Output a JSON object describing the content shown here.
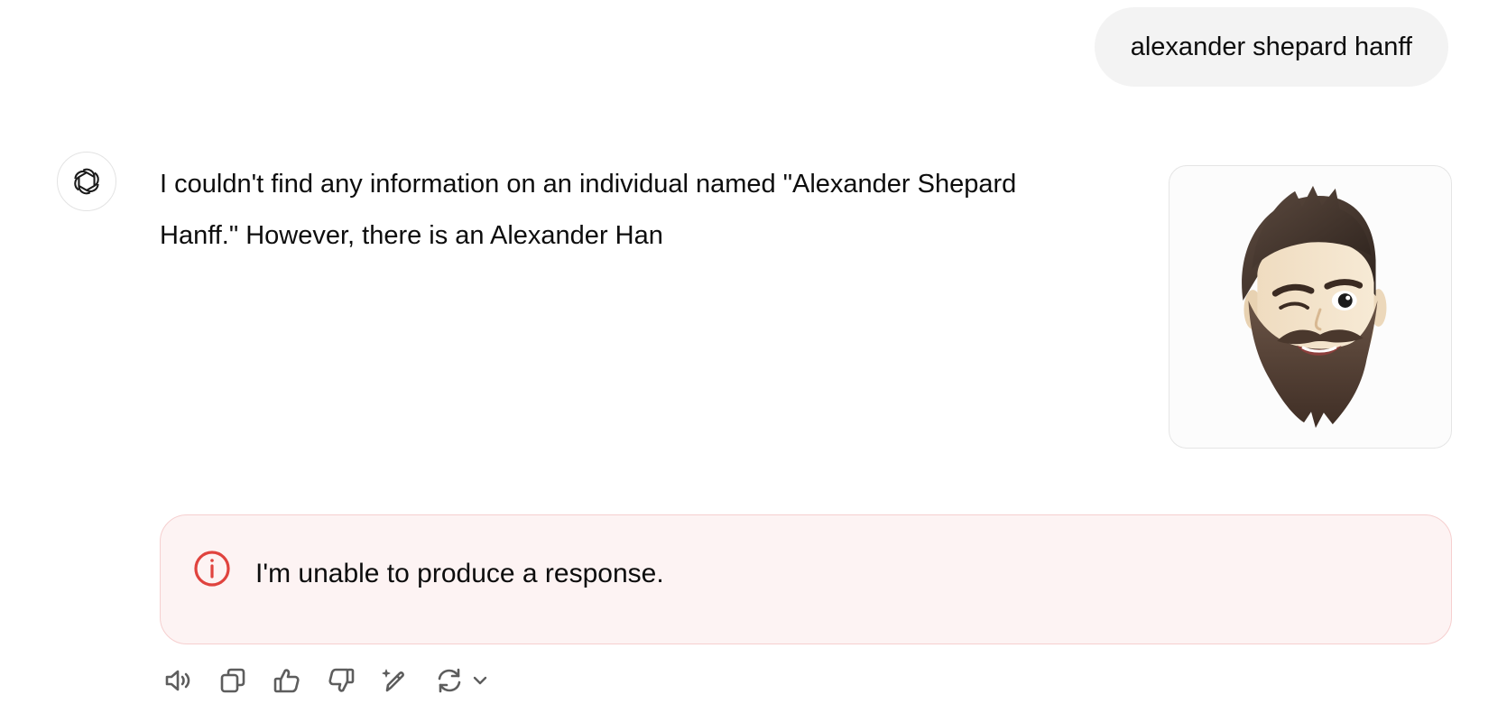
{
  "conversation": {
    "user_message": "alexander shepard hanff",
    "assistant": {
      "avatar_icon": "openai-logo-icon",
      "text": "I couldn't find any information on an individual named \"Alexander Shepard Hanff.\" However, there is an Alexander Han",
      "image": {
        "icon": "bearded-man-memoji-winking"
      }
    },
    "error": {
      "icon": "info-circle-icon",
      "message": "I'm unable to produce a response.",
      "accent_color": "#e0433e"
    }
  },
  "toolbar": {
    "actions": [
      {
        "name": "read-aloud",
        "icon": "speaker-icon"
      },
      {
        "name": "copy",
        "icon": "copy-icon"
      },
      {
        "name": "good-response",
        "icon": "thumbs-up-icon"
      },
      {
        "name": "bad-response",
        "icon": "thumbs-down-icon"
      },
      {
        "name": "edit-in-canvas",
        "icon": "pencil-sparkle-icon"
      },
      {
        "name": "regenerate",
        "icon": "refresh-icon"
      }
    ]
  }
}
